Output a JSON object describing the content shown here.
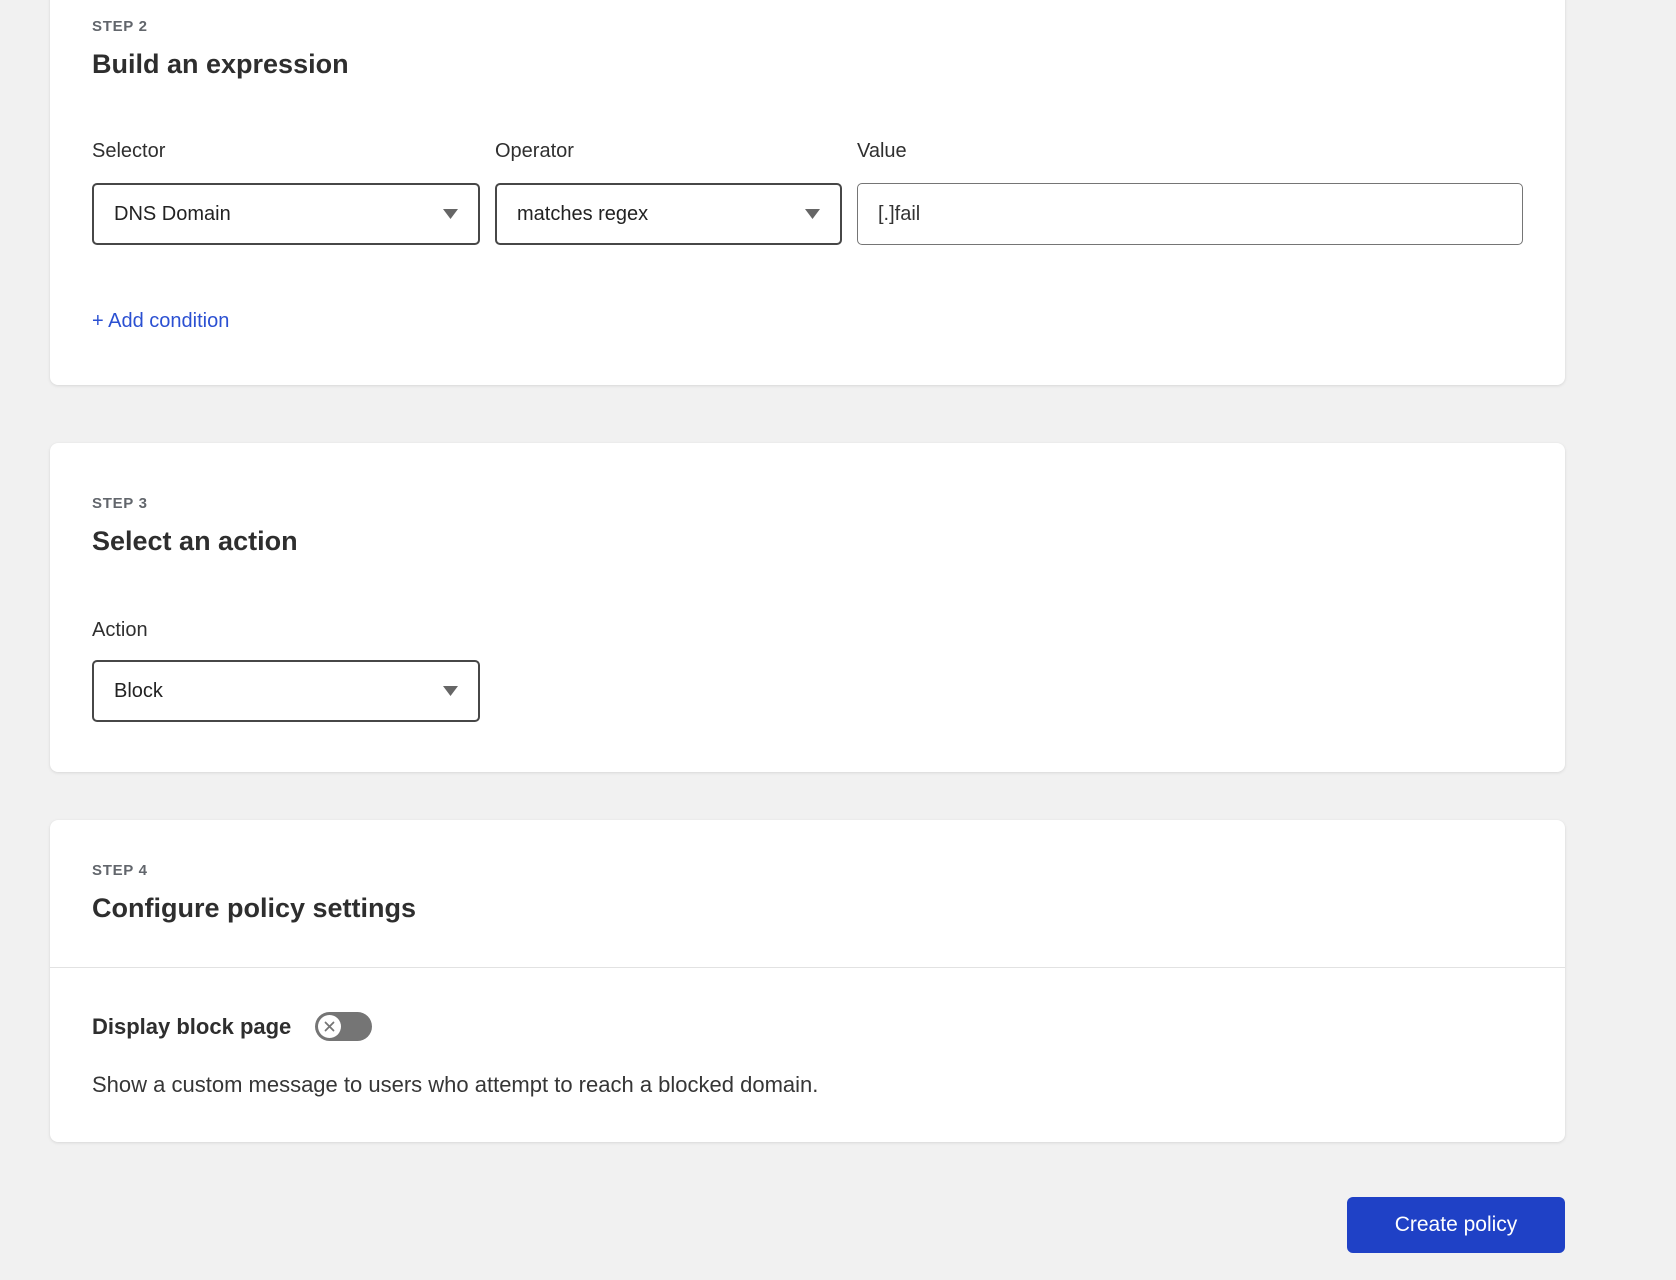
{
  "colors": {
    "page_background": "#f1f1f1",
    "link_blue": "#2b50d2",
    "button_blue": "#1f41c6",
    "toggle_off_gray": "#757575"
  },
  "icons": {
    "caret_down": "triangle-down",
    "toggle_knob": "x-in-circle"
  },
  "step2": {
    "step_label": "STEP 2",
    "title": "Build an expression",
    "selector": {
      "label": "Selector",
      "value": "DNS Domain"
    },
    "operator": {
      "label": "Operator",
      "value": "matches regex"
    },
    "value_field": {
      "label": "Value",
      "value": "[.]fail"
    },
    "add_condition_label": "+ Add condition"
  },
  "step3": {
    "step_label": "STEP 3",
    "title": "Select an action",
    "action": {
      "label": "Action",
      "value": "Block"
    }
  },
  "step4": {
    "step_label": "STEP 4",
    "title": "Configure policy settings",
    "display_block_page": {
      "label": "Display block page",
      "toggle_state": "off",
      "description": "Show a custom message to users who attempt to reach a blocked domain."
    }
  },
  "footer": {
    "create_policy_label": "Create policy"
  }
}
